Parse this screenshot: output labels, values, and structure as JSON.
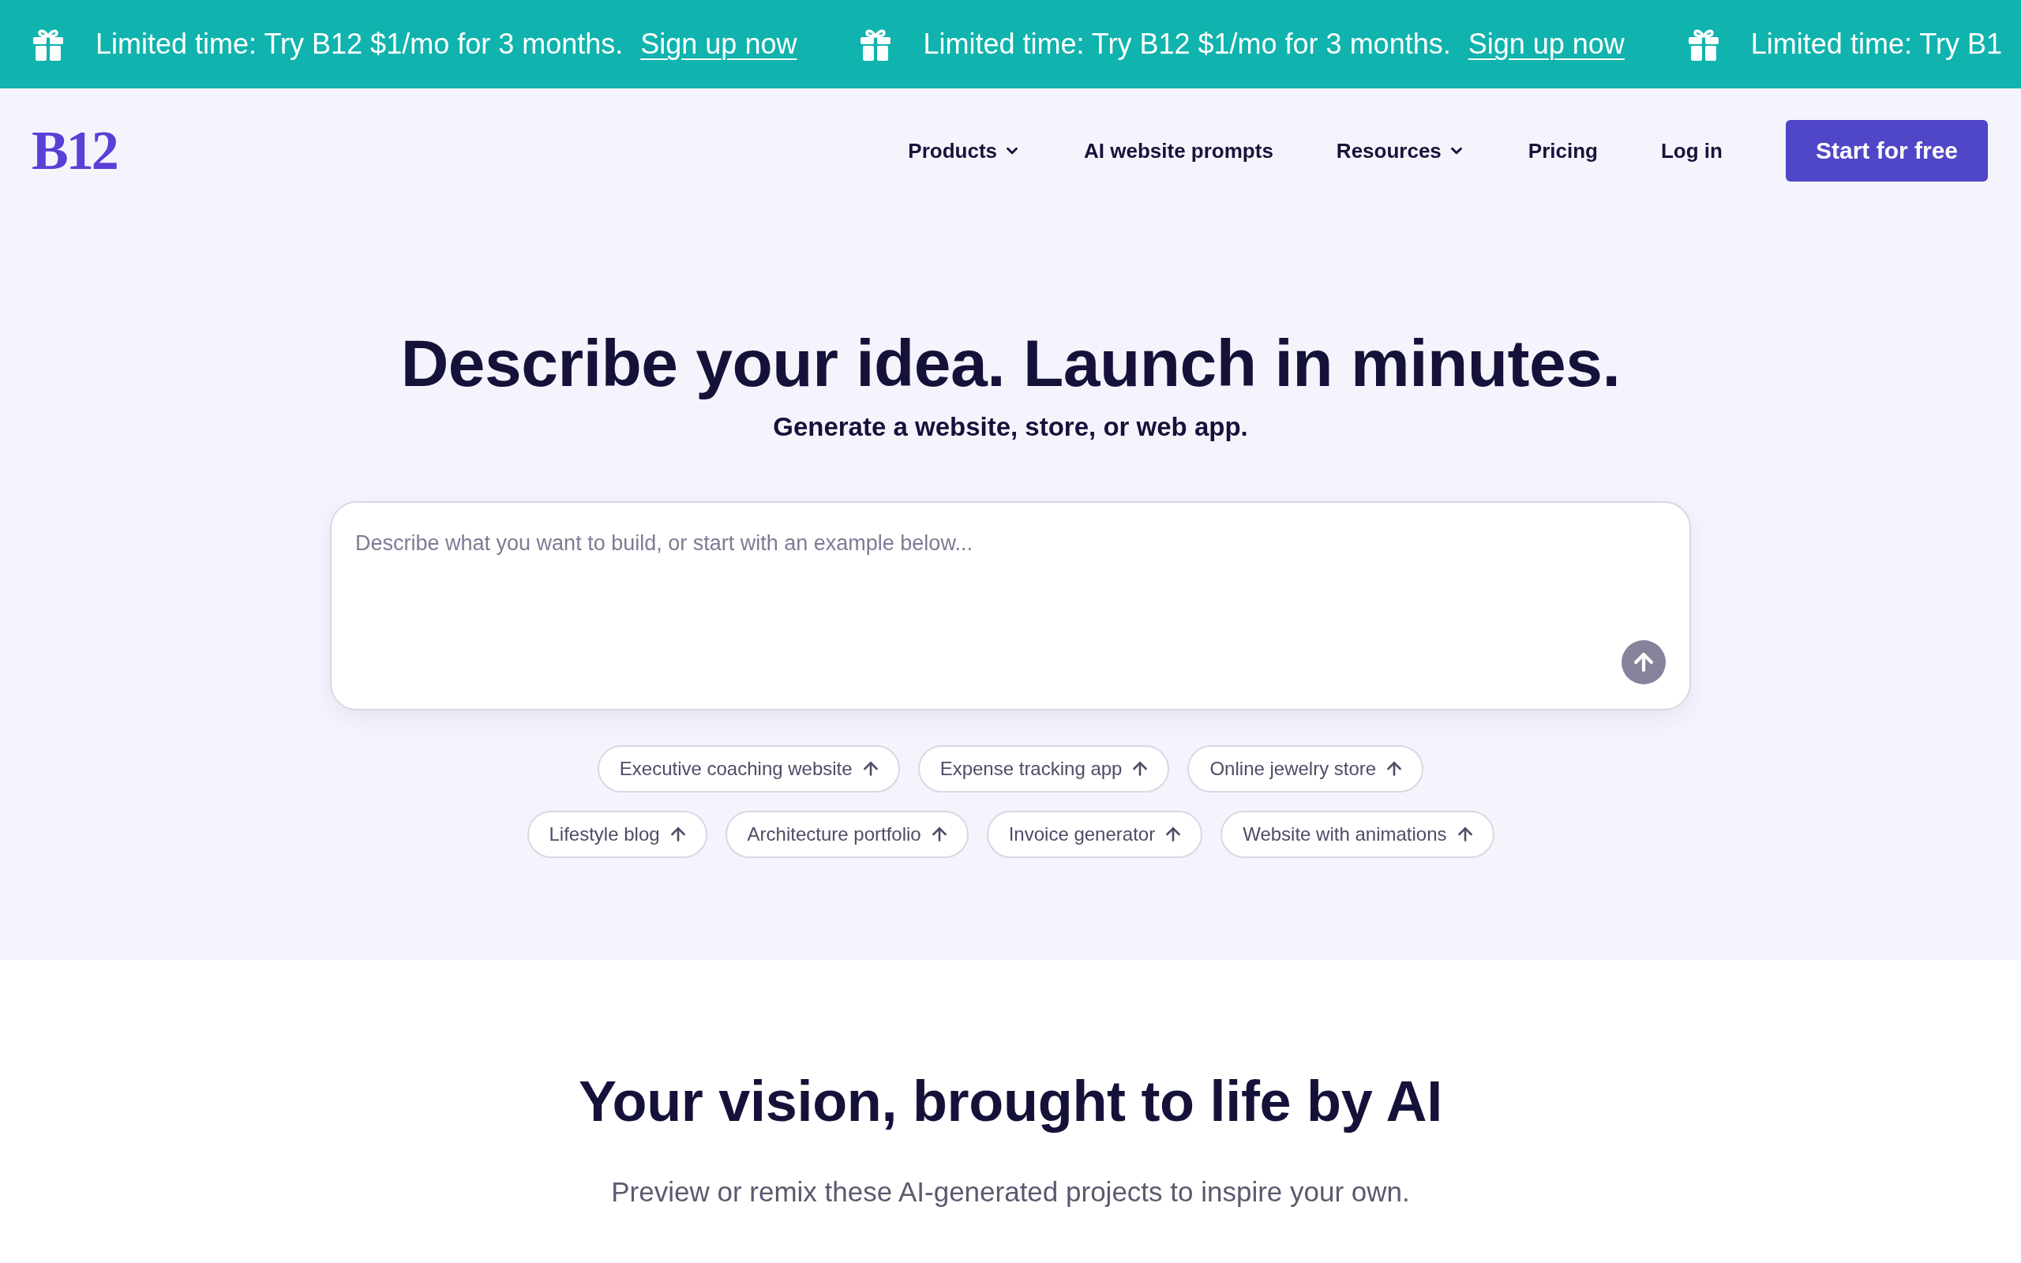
{
  "promo_banner": {
    "items": [
      {
        "message": "Limited time: Try B12 $1/mo for 3 months.",
        "link": "Sign up now"
      },
      {
        "message": "Limited time: Try B12 $1/mo for 3 months.",
        "link": "Sign up now"
      },
      {
        "message": "Limited time: Try B1"
      }
    ]
  },
  "nav": {
    "logo": "B12",
    "links": [
      {
        "label": "Products",
        "dropdown": true
      },
      {
        "label": "AI website prompts",
        "dropdown": false
      },
      {
        "label": "Resources",
        "dropdown": true
      },
      {
        "label": "Pricing",
        "dropdown": false
      },
      {
        "label": "Log in",
        "dropdown": false
      }
    ],
    "cta": "Start for free"
  },
  "hero": {
    "title": "Describe your idea. Launch in minutes.",
    "subtitle": "Generate a website, store, or web app.",
    "prompt": {
      "placeholder": "Describe what you want to build, or start with an example below..."
    },
    "example_rows": [
      [
        "Executive coaching website",
        "Expense tracking app",
        "Online jewelry store"
      ],
      [
        "Lifestyle blog",
        "Architecture portfolio",
        "Invoice generator",
        "Website with animations"
      ]
    ]
  },
  "showcase": {
    "title": "Your vision, brought to life by AI",
    "subtitle": "Preview or remix these AI-generated projects to inspire your own."
  }
}
